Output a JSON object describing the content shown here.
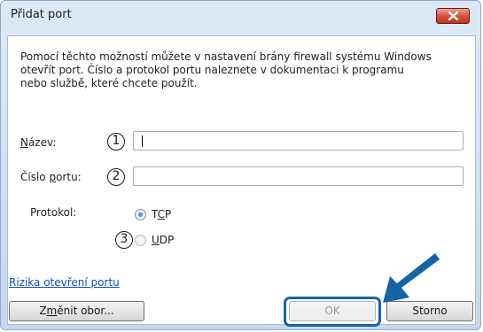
{
  "window": {
    "title": "Přidat port",
    "close_icon": "close-icon"
  },
  "description": {
    "line1": "Pomocí těchto možností můžete v nastavení brány firewall systému Windows",
    "line2": "otevřít port. Číslo a protokol portu naleznete v dokumentaci k programu",
    "line3": "nebo službě, které chcete použít."
  },
  "fields": {
    "name": {
      "label_pre": "",
      "label_ul": "N",
      "label_post": "ázev:",
      "value": ""
    },
    "port": {
      "label_pre": "Číslo ",
      "label_ul": "p",
      "label_post": "ortu:",
      "value": ""
    }
  },
  "protocol": {
    "label": "Protokol:",
    "tcp": {
      "pre": "T",
      "ul": "C",
      "post": "P",
      "selected": true
    },
    "udp": {
      "pre": "",
      "ul": "U",
      "post": "DP",
      "selected": false
    }
  },
  "callouts": [
    "1",
    "2",
    "3"
  ],
  "link": {
    "text": "Rizika otevření portu"
  },
  "buttons": {
    "change_scope": {
      "pre": "Z",
      "ul": "m",
      "post": "ěnit obor..."
    },
    "ok": "OK",
    "cancel": "Storno"
  },
  "colors": {
    "accent_arrow": "#1763a8",
    "link": "#0a4ec7",
    "close": "#c0321c"
  }
}
